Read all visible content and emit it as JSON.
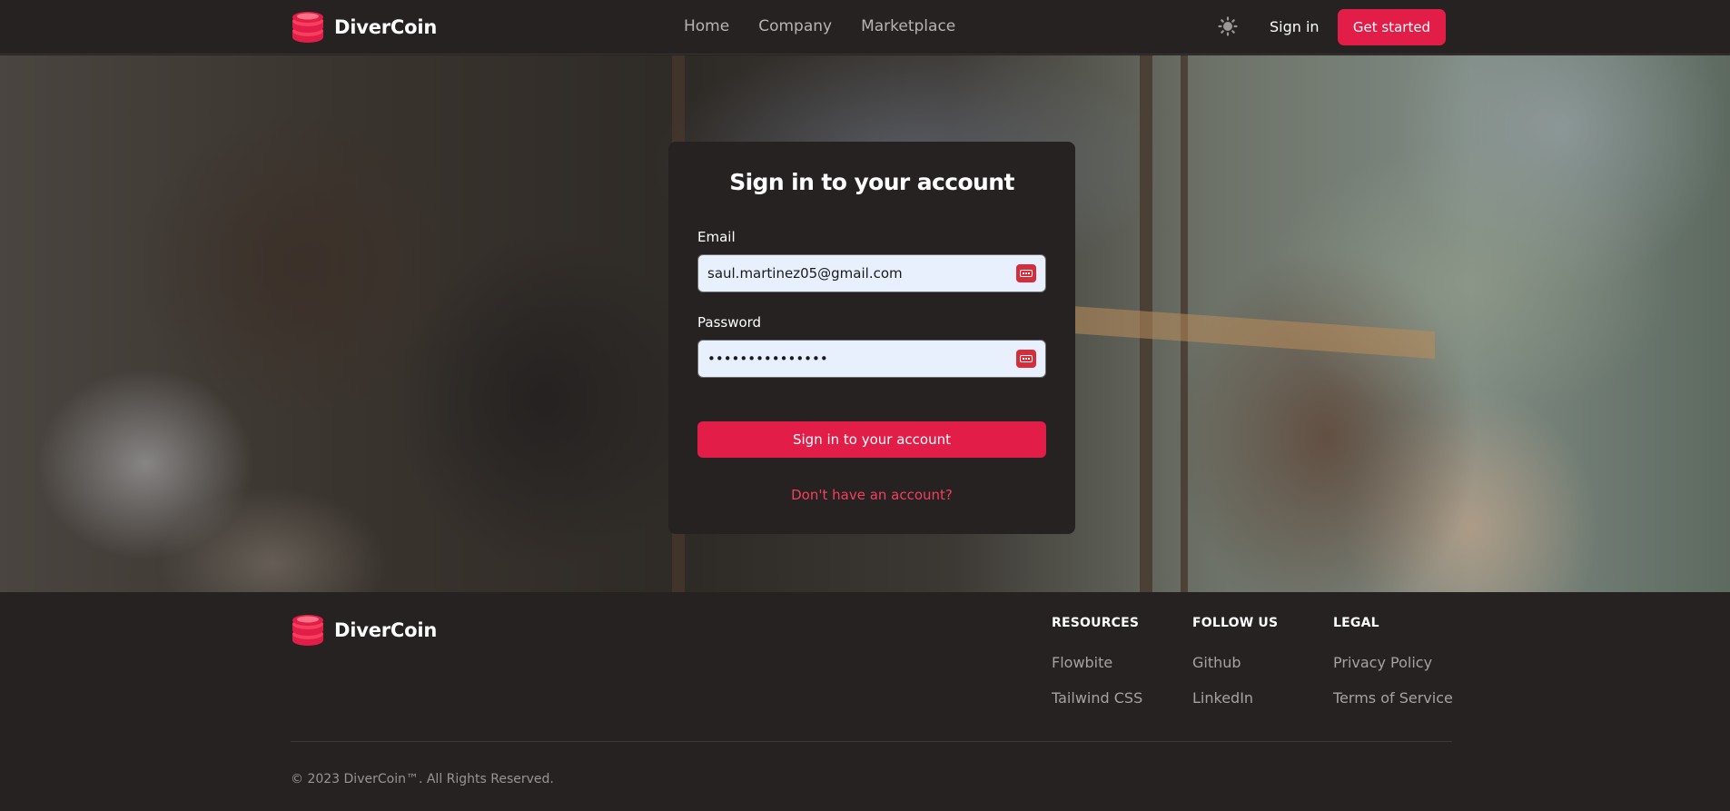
{
  "navbar": {
    "brand": "DiverCoin",
    "links": [
      "Home",
      "Company",
      "Marketplace"
    ],
    "theme_icon": "sun-icon",
    "signin_label": "Sign in",
    "cta_label": "Get started"
  },
  "login": {
    "title": "Sign in to your account",
    "email_label": "Email",
    "email_value": "saul.martinez05@gmail.com",
    "password_label": "Password",
    "password_value": "•••••••••••••••",
    "submit_label": "Sign in to your account",
    "signup_link": "Don't have an account?"
  },
  "footer": {
    "brand": "DiverCoin",
    "columns": [
      {
        "heading": "RESOURCES",
        "links": [
          "Flowbite",
          "Tailwind CSS"
        ]
      },
      {
        "heading": "FOLLOW US",
        "links": [
          "Github",
          "LinkedIn"
        ]
      },
      {
        "heading": "LEGAL",
        "links": [
          "Privacy Policy",
          "Terms of Service"
        ]
      }
    ],
    "copyright": "© 2023 DiverCoin™. All Rights Reserved."
  },
  "colors": {
    "accent": "#e11d48",
    "background": "#262222",
    "link_accent": "#f43f5e"
  }
}
